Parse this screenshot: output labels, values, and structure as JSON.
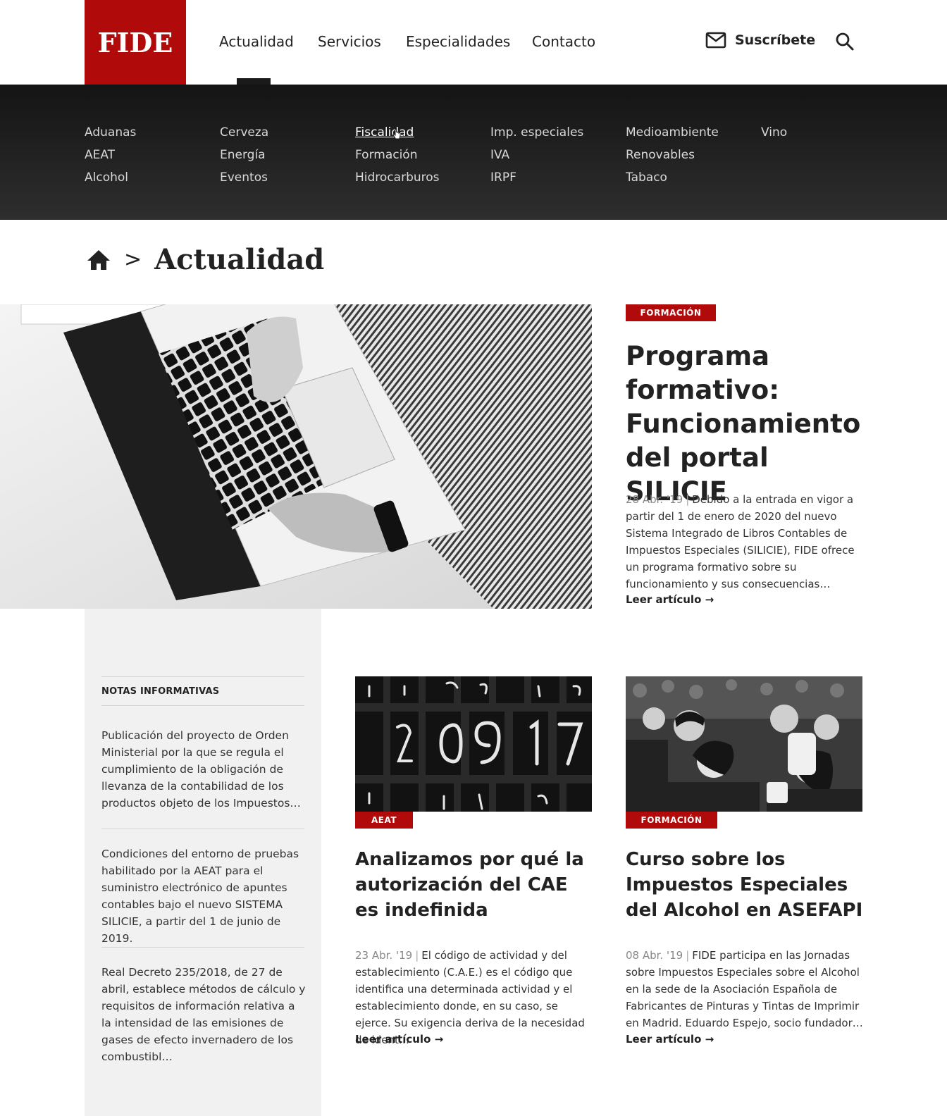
{
  "header": {
    "logo": "FIDE",
    "nav": [
      "Actualidad",
      "Servicios",
      "Especialidades",
      "Contacto"
    ],
    "subscribe_label": "Suscríbete",
    "brand_color": "#b00a0a"
  },
  "mega_menu": {
    "columns": [
      [
        "Aduanas",
        "AEAT",
        "Alcohol"
      ],
      [
        "Cerveza",
        "Energía",
        "Eventos"
      ],
      [
        "Fiscalidad",
        "Formación",
        "Hidrocarburos"
      ],
      [
        "Imp. especiales",
        "IVA",
        "IRPF"
      ],
      [
        "Medioambiente",
        "Renovables",
        "Tabaco"
      ],
      [
        "Vino"
      ]
    ],
    "hovered": "Fiscalidad"
  },
  "breadcrumb": {
    "separator": ">",
    "title": "Actualidad"
  },
  "hero": {
    "tag": "FORMACIÓN",
    "title": "Programa formativo: Funcionamiento del portal SILICIE",
    "date": "28 Abr. '19",
    "excerpt": "Debido a la entrada en vigor a partir del 1 de enero de 2020 del nuevo Sistema Integrado de Libros Contables de Impuestos Especiales (SILICIE), FIDE ofrece un programa formativo sobre su funcionamiento y sus consecuencias…",
    "read_more": "Leer artículo",
    "arrow": "→"
  },
  "sidebar": {
    "heading": "NOTAS INFORMATIVAS",
    "items": [
      "Publicación del proyecto de Orden Ministerial por la que se regula el cumplimiento de la obligación de llevanza de la contabilidad de los productos objeto de los Impuestos…",
      "Condiciones del entorno de pruebas habilitado por la AEAT para el suministro electrónico de apuntes contables bajo el nuevo SISTEMA SILICIE, a partir del 1 de junio de 2019.",
      "Real Decreto 235/2018, de 27 de abril, establece métodos de cálculo y requisitos de información relativa a la intensidad de las emisiones de gases de efecto invernadero de los combustibl…"
    ]
  },
  "cards": [
    {
      "tag": "AEAT",
      "title": "Analizamos por qué la autorización del CAE es indefinida",
      "date": "23 Abr. '19",
      "excerpt": "El código de actividad y del establecimiento (C.A.E.) es el código que identifica una determinada actividad y el establecimiento donde, en su caso, se ejerce. Su exigencia deriva de la necesidad de ident…",
      "read_more": "Leer artículo",
      "arrow": "→"
    },
    {
      "tag": "FORMACIÓN",
      "title": "Curso sobre los Impuestos Especiales del Alcohol en ASEFAPI",
      "date": "08 Abr. '19",
      "excerpt": "FIDE participa en las Jornadas sobre Impuestos Especiales sobre el Alcohol en la sede de la Asociación Española de Fabricantes de Pinturas y Tintas de Imprimir en Madrid. Eduardo Espejo, socio fundador…",
      "read_more": "Leer artículo",
      "arrow": "→"
    }
  ]
}
